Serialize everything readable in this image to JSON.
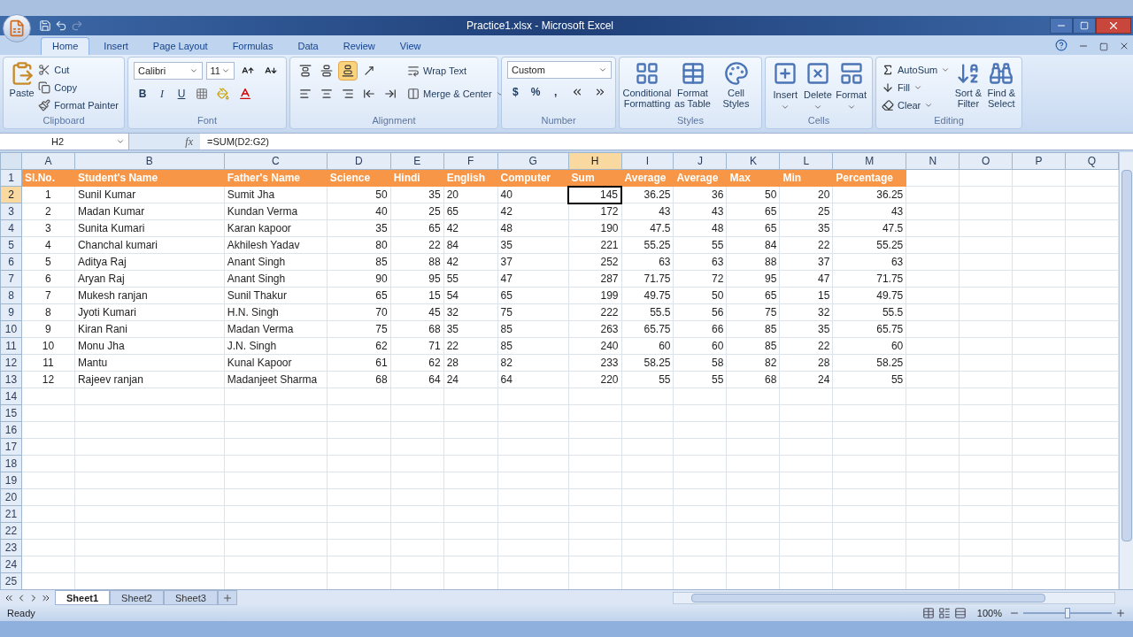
{
  "window": {
    "title": "Practice1.xlsx - Microsoft Excel"
  },
  "ribbon_tabs": [
    {
      "label": "Home",
      "selected": true
    },
    {
      "label": "Insert",
      "selected": false
    },
    {
      "label": "Page Layout",
      "selected": false
    },
    {
      "label": "Formulas",
      "selected": false
    },
    {
      "label": "Data",
      "selected": false
    },
    {
      "label": "Review",
      "selected": false
    },
    {
      "label": "View",
      "selected": false
    }
  ],
  "ribbon_groups": [
    {
      "kind": "clipboard",
      "name": "Clipboard",
      "paste": "Paste",
      "actions": [
        "Cut",
        "Copy",
        "Format Painter"
      ]
    },
    {
      "kind": "font",
      "name": "Font",
      "font": "Calibri",
      "size": "11",
      "styles": [
        "B",
        "I",
        "U"
      ]
    },
    {
      "kind": "alignment",
      "name": "Alignment",
      "vertical": [
        {
          "selected": false
        },
        {
          "selected": false
        },
        {
          "selected": true
        }
      ],
      "wrap": "Wrap Text",
      "merge": "Merge & Center"
    },
    {
      "kind": "number",
      "name": "Number",
      "format": "Custom",
      "symbols": [
        "$",
        "%",
        ","
      ]
    },
    {
      "kind": "styles",
      "name": "Styles",
      "buttons": [
        "Conditional Formatting",
        "Format as Table",
        "Cell Styles"
      ]
    },
    {
      "kind": "cells",
      "name": "Cells",
      "buttons": [
        "Insert",
        "Delete",
        "Format"
      ]
    },
    {
      "kind": "editing",
      "name": "Editing",
      "actions": [
        "AutoSum",
        "Fill",
        "Clear"
      ],
      "buttons": [
        "Sort & Filter",
        "Find & Select"
      ]
    }
  ],
  "formula_bar": {
    "name_box": "H2",
    "fx": "fx",
    "formula": "=SUM(D2:G2)"
  },
  "columns": [
    {
      "letter": "A",
      "kind": "center",
      "selected": false
    },
    {
      "letter": "B",
      "kind": "text",
      "selected": false
    },
    {
      "letter": "C",
      "kind": "text",
      "selected": false
    },
    {
      "letter": "D",
      "kind": "number",
      "selected": false
    },
    {
      "letter": "E",
      "kind": "number",
      "selected": false
    },
    {
      "letter": "F",
      "kind": "text",
      "selected": false
    },
    {
      "letter": "G",
      "kind": "text",
      "selected": false
    },
    {
      "letter": "H",
      "kind": "number",
      "selected": true
    },
    {
      "letter": "I",
      "kind": "number",
      "selected": false
    },
    {
      "letter": "J",
      "kind": "number",
      "selected": false
    },
    {
      "letter": "K",
      "kind": "number",
      "selected": false
    },
    {
      "letter": "L",
      "kind": "number",
      "selected": false
    },
    {
      "letter": "M",
      "kind": "number",
      "selected": false
    },
    {
      "letter": "N",
      "kind": "text",
      "selected": false
    },
    {
      "letter": "O",
      "kind": "text",
      "selected": false
    },
    {
      "letter": "P",
      "kind": "text",
      "selected": false
    },
    {
      "letter": "Q",
      "kind": "text",
      "selected": false
    }
  ],
  "rows": [
    {
      "number": "1",
      "selected": false,
      "kind": "header",
      "cells": [
        "Sl.No.",
        "Student's Name",
        "Father's Name",
        "Science",
        "Hindi",
        "English",
        "Computer",
        "Sum",
        "Average",
        "Average",
        "Max",
        "Min",
        "Percentage"
      ]
    },
    {
      "number": "2",
      "selected": true,
      "kind": "data",
      "cells": [
        "1",
        "Sunil Kumar",
        "Sumit Jha",
        "50",
        "35",
        "20",
        "40",
        "145",
        "36.25",
        "36",
        "50",
        "20",
        "36.25"
      ]
    },
    {
      "number": "3",
      "selected": false,
      "kind": "data",
      "cells": [
        "2",
        "Madan Kumar",
        "Kundan Verma",
        "40",
        "25",
        "65",
        "42",
        "172",
        "43",
        "43",
        "65",
        "25",
        "43"
      ]
    },
    {
      "number": "4",
      "selected": false,
      "kind": "data",
      "cells": [
        "3",
        "Sunita Kumari",
        "Karan kapoor",
        "35",
        "65",
        "42",
        "48",
        "190",
        "47.5",
        "48",
        "65",
        "35",
        "47.5"
      ]
    },
    {
      "number": "5",
      "selected": false,
      "kind": "data",
      "cells": [
        "4",
        "Chanchal kumari",
        "Akhilesh Yadav",
        "80",
        "22",
        "84",
        "35",
        "221",
        "55.25",
        "55",
        "84",
        "22",
        "55.25"
      ]
    },
    {
      "number": "6",
      "selected": false,
      "kind": "data",
      "cells": [
        "5",
        "Aditya Raj",
        "Anant Singh",
        "85",
        "88",
        "42",
        "37",
        "252",
        "63",
        "63",
        "88",
        "37",
        "63"
      ]
    },
    {
      "number": "7",
      "selected": false,
      "kind": "data",
      "cells": [
        "6",
        "Aryan Raj",
        "Anant Singh",
        "90",
        "95",
        "55",
        "47",
        "287",
        "71.75",
        "72",
        "95",
        "47",
        "71.75"
      ]
    },
    {
      "number": "8",
      "selected": false,
      "kind": "data",
      "cells": [
        "7",
        "Mukesh ranjan",
        "Sunil Thakur",
        "65",
        "15",
        "54",
        "65",
        "199",
        "49.75",
        "50",
        "65",
        "15",
        "49.75"
      ]
    },
    {
      "number": "9",
      "selected": false,
      "kind": "data",
      "cells": [
        "8",
        "Jyoti Kumari",
        "H.N. Singh",
        "70",
        "45",
        "32",
        "75",
        "222",
        "55.5",
        "56",
        "75",
        "32",
        "55.5"
      ]
    },
    {
      "number": "10",
      "selected": false,
      "kind": "data",
      "cells": [
        "9",
        "Kiran Rani",
        "Madan Verma",
        "75",
        "68",
        "35",
        "85",
        "263",
        "65.75",
        "66",
        "85",
        "35",
        "65.75"
      ]
    },
    {
      "number": "11",
      "selected": false,
      "kind": "data",
      "cells": [
        "10",
        "Monu Jha",
        "J.N. Singh",
        "62",
        "71",
        "22",
        "85",
        "240",
        "60",
        "60",
        "85",
        "22",
        "60"
      ]
    },
    {
      "number": "12",
      "selected": false,
      "kind": "data",
      "cells": [
        "11",
        "Mantu",
        "Kunal Kapoor",
        "61",
        "62",
        "28",
        "82",
        "233",
        "58.25",
        "58",
        "82",
        "28",
        "58.25"
      ]
    },
    {
      "number": "13",
      "selected": false,
      "kind": "data",
      "cells": [
        "12",
        "Rajeev ranjan",
        "Madanjeet Sharma",
        "68",
        "64",
        "24",
        "64",
        "220",
        "55",
        "55",
        "68",
        "24",
        "55"
      ]
    },
    {
      "number": "14",
      "selected": false
    },
    {
      "number": "15",
      "selected": false
    },
    {
      "number": "16",
      "selected": false
    },
    {
      "number": "17",
      "selected": false
    },
    {
      "number": "18",
      "selected": false
    },
    {
      "number": "19",
      "selected": false
    },
    {
      "number": "20",
      "selected": false
    },
    {
      "number": "21",
      "selected": false
    },
    {
      "number": "22",
      "selected": false
    },
    {
      "number": "23",
      "selected": false
    },
    {
      "number": "24",
      "selected": false
    },
    {
      "number": "25",
      "selected": false
    }
  ],
  "sheets": [
    {
      "label": "Sheet1",
      "selected": true
    },
    {
      "label": "Sheet2",
      "selected": false
    },
    {
      "label": "Sheet3",
      "selected": false
    }
  ],
  "status_bar": {
    "status": "Ready",
    "zoom": "100%",
    "zoom_slider": {
      "level": 0.5
    }
  }
}
